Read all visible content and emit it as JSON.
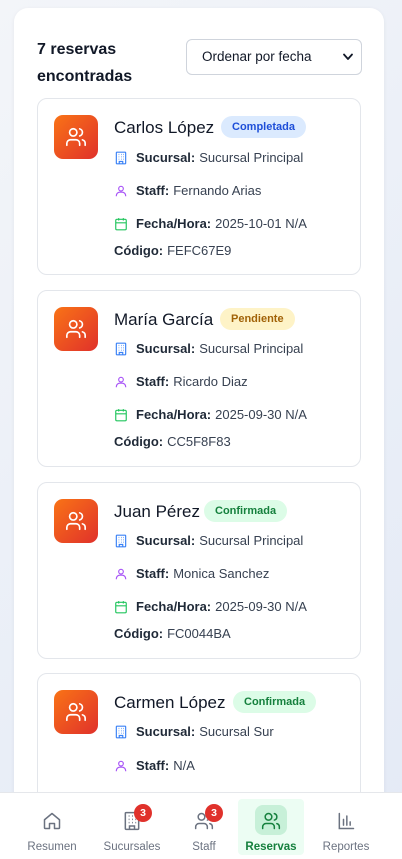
{
  "results": {
    "count_text": "7 reservas encontradas",
    "sort": {
      "selected": "Ordenar por fecha"
    }
  },
  "labels": {
    "sucursal": "Sucursal:",
    "staff": "Staff:",
    "fecha": "Fecha/Hora:",
    "codigo": "Código:"
  },
  "reservations": [
    {
      "name": "Carlos López",
      "status": "Completada",
      "sucursal": "Sucursal Principal",
      "staff": "Fernando Arias",
      "fecha": "2025-10-01 N/A",
      "codigo": "FEFC67E9"
    },
    {
      "name": "María García",
      "status": "Pendiente",
      "sucursal": "Sucursal Principal",
      "staff": "Ricardo Diaz",
      "fecha": "2025-09-30 N/A",
      "codigo": "CC5F8F83"
    },
    {
      "name": "Juan Pérez",
      "status": "Confirmada",
      "sucursal": "Sucursal Principal",
      "staff": "Monica Sanchez",
      "fecha": "2025-09-30 N/A",
      "codigo": "FC0044BA"
    },
    {
      "name": "Carmen López",
      "status": "Confirmada",
      "sucursal": "Sucursal Sur",
      "staff": "N/A"
    }
  ],
  "nav": {
    "items": [
      {
        "label": "Resumen",
        "icon": "home-icon"
      },
      {
        "label": "Sucursales",
        "icon": "building-icon",
        "badge": "3"
      },
      {
        "label": "Staff",
        "icon": "users-icon",
        "badge": "3"
      },
      {
        "label": "Reservas",
        "icon": "users-icon",
        "active": true
      },
      {
        "label": "Reportes",
        "icon": "bar-chart-icon"
      }
    ]
  },
  "colors": {
    "accent_green": "#15803d",
    "avatar_gradient_start": "#f97316",
    "avatar_gradient_end": "#e0312b",
    "badge_red": "#e0312b"
  }
}
